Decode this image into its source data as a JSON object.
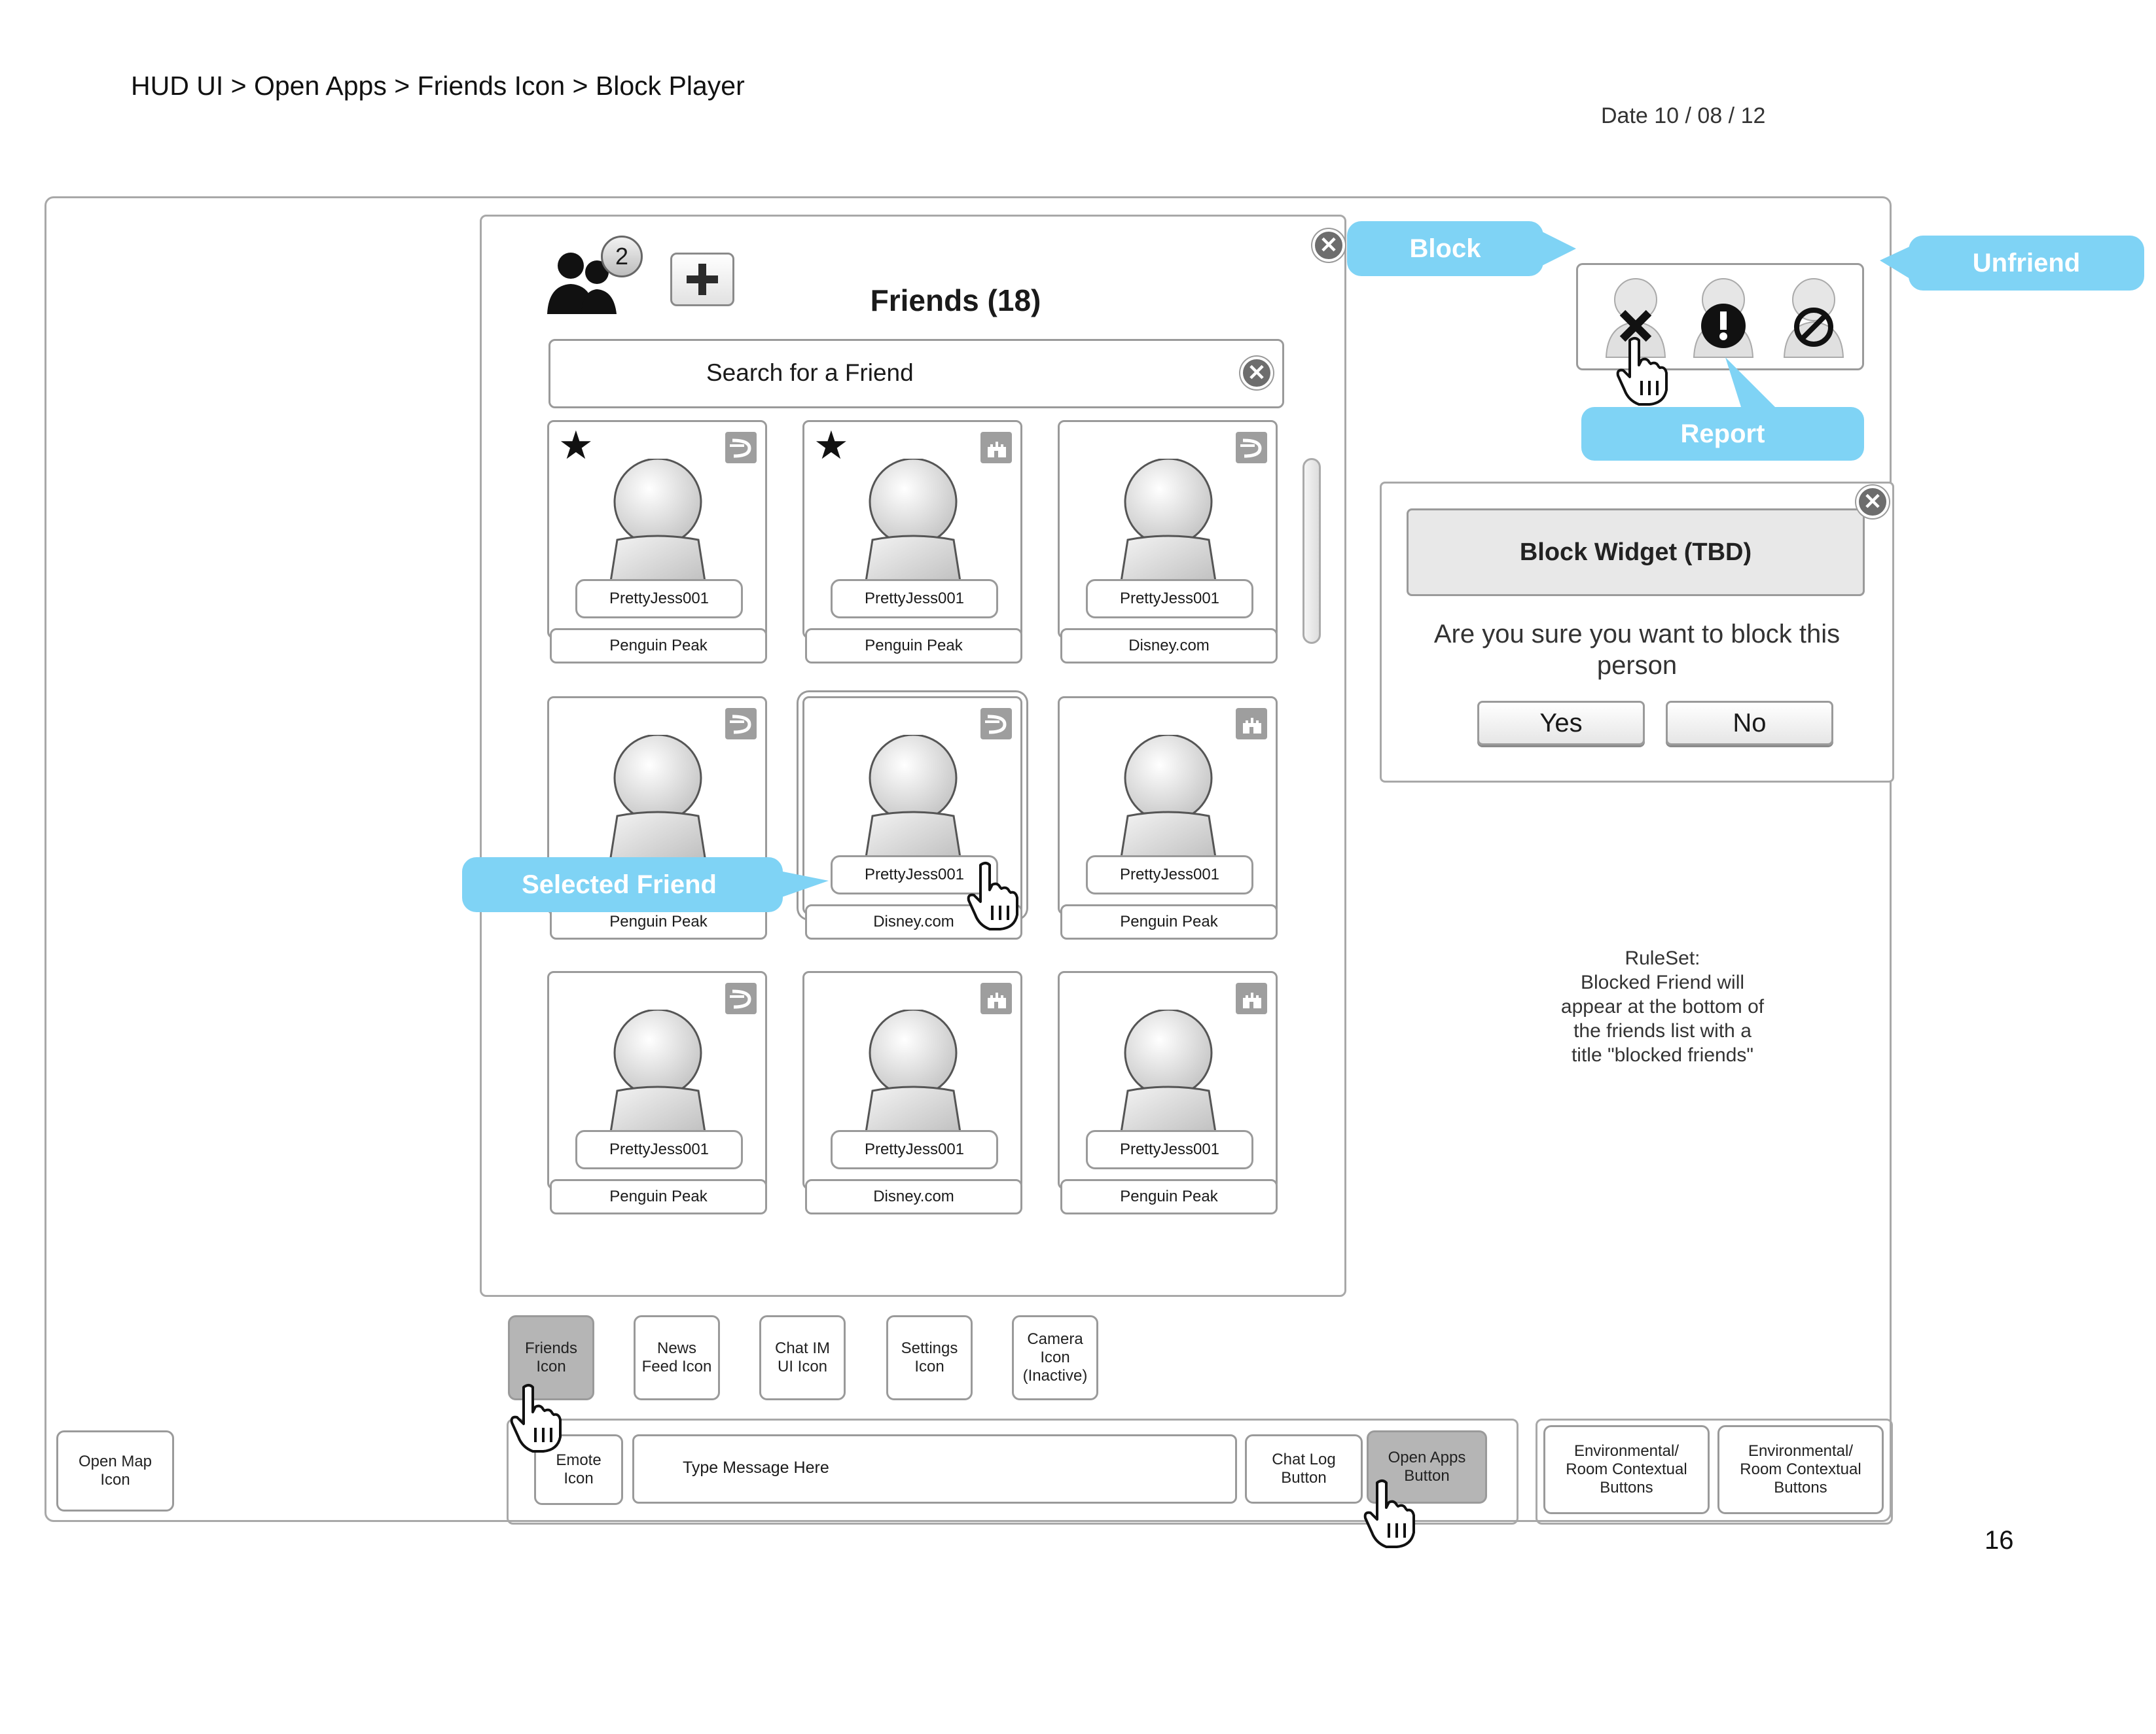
{
  "header": {
    "breadcrumb": "HUD UI > Open Apps > Friends Icon > Block Player",
    "date": "Date 10 / 08 / 12",
    "page_number": "16"
  },
  "friends_panel": {
    "title": "Friends (18)",
    "badge_count": "2",
    "search_placeholder": "Search for a Friend",
    "cards": [
      {
        "name": "PrettyJess001",
        "location": "Penguin Peak",
        "favorite": true,
        "icon": "disney-d-icon"
      },
      {
        "name": "PrettyJess001",
        "location": "Penguin Peak",
        "favorite": true,
        "icon": "castle-icon"
      },
      {
        "name": "PrettyJess001",
        "location": "Disney.com",
        "favorite": false,
        "icon": "disney-d-icon"
      },
      {
        "name": "",
        "location": "Penguin Peak",
        "favorite": false,
        "icon": "disney-d-icon"
      },
      {
        "name": "PrettyJess001",
        "location": "Disney.com",
        "favorite": false,
        "icon": "disney-d-icon",
        "selected": true
      },
      {
        "name": "PrettyJess001",
        "location": "Penguin Peak",
        "favorite": false,
        "icon": "castle-icon"
      },
      {
        "name": "PrettyJess001",
        "location": "Penguin Peak",
        "favorite": false,
        "icon": "disney-d-icon"
      },
      {
        "name": "PrettyJess001",
        "location": "Disney.com",
        "favorite": false,
        "icon": "castle-icon"
      },
      {
        "name": "PrettyJess001",
        "location": "Penguin Peak",
        "favorite": false,
        "icon": "castle-icon"
      }
    ]
  },
  "callouts": {
    "block": "Block",
    "unfriend": "Unfriend",
    "report": "Report",
    "selected_friend": "Selected Friend"
  },
  "block_dialog": {
    "title": "Block Widget (TBD)",
    "message": "Are you sure you want to block this person",
    "yes": "Yes",
    "no": "No"
  },
  "ruleset": {
    "heading": "RuleSet:",
    "lines": [
      "Blocked Friend will",
      "appear at the bottom of",
      "the friends list with a",
      "title \"blocked friends\""
    ]
  },
  "app_icons": [
    {
      "label": "Friends Icon",
      "active": true
    },
    {
      "label": "News Feed Icon",
      "active": false
    },
    {
      "label": "Chat IM UI Icon",
      "active": false
    },
    {
      "label": "Settings Icon",
      "active": false
    },
    {
      "label": "Camera Icon (Inactive)",
      "active": false
    }
  ],
  "hud_bar": {
    "open_map": "Open Map Icon",
    "emote": "Emote Icon",
    "message_placeholder": "Type Message Here",
    "chat_log": "Chat Log Button",
    "open_apps": "Open Apps Button",
    "env_buttons": [
      "Environmental/ Room Contextual Buttons",
      "Environmental/ Room Contextual Buttons"
    ]
  },
  "colors": {
    "callout": "#7fd3f5",
    "active_button": "#b5b5b5",
    "border": "#9a9a9a"
  }
}
